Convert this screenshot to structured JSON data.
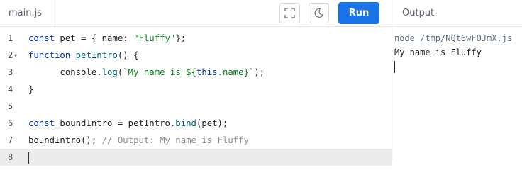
{
  "editor": {
    "file_tab": "main.js",
    "run_label": "Run",
    "icons": [
      "fullscreen-icon",
      "theme-toggle-icon"
    ],
    "lines": [
      {
        "num": "1",
        "fold": "",
        "tokens": [
          {
            "t": "const ",
            "c": "kw"
          },
          {
            "t": "pet = { name: ",
            "c": ""
          },
          {
            "t": "\"Fluffy\"",
            "c": "str"
          },
          {
            "t": "};",
            "c": ""
          }
        ]
      },
      {
        "num": "2",
        "fold": "▾",
        "tokens": [
          {
            "t": "function ",
            "c": "kw"
          },
          {
            "t": "petIntro",
            "c": "fn"
          },
          {
            "t": "() {",
            "c": ""
          }
        ]
      },
      {
        "num": "3",
        "fold": "",
        "tokens": [
          {
            "t": "      console.",
            "c": ""
          },
          {
            "t": "log",
            "c": "fn"
          },
          {
            "t": "(",
            "c": ""
          },
          {
            "t": "`My name is ${",
            "c": "tpl"
          },
          {
            "t": "this",
            "c": "this"
          },
          {
            "t": ".name}`",
            "c": "tpl"
          },
          {
            "t": ");",
            "c": ""
          }
        ]
      },
      {
        "num": "4",
        "fold": "",
        "tokens": [
          {
            "t": "}",
            "c": ""
          }
        ]
      },
      {
        "num": "5",
        "fold": "",
        "tokens": []
      },
      {
        "num": "6",
        "fold": "",
        "tokens": [
          {
            "t": "const ",
            "c": "kw"
          },
          {
            "t": "boundIntro = petIntro.",
            "c": ""
          },
          {
            "t": "bind",
            "c": "fn"
          },
          {
            "t": "(pet);",
            "c": ""
          }
        ]
      },
      {
        "num": "7",
        "fold": "",
        "tokens": [
          {
            "t": "boundIntro(); ",
            "c": ""
          },
          {
            "t": "// Output: My name is Fluffy",
            "c": "cm"
          }
        ]
      },
      {
        "num": "8",
        "fold": "",
        "tokens": [],
        "active": true,
        "cursor": true
      }
    ]
  },
  "output": {
    "header": "Output",
    "command": "node /tmp/NQt6wFOJmX.js",
    "result": "My name is Fluffy"
  },
  "colors": {
    "run_button": "#1a73e8",
    "keyword": "#0033b3",
    "string": "#067d17",
    "comment": "#8c8c8c"
  }
}
